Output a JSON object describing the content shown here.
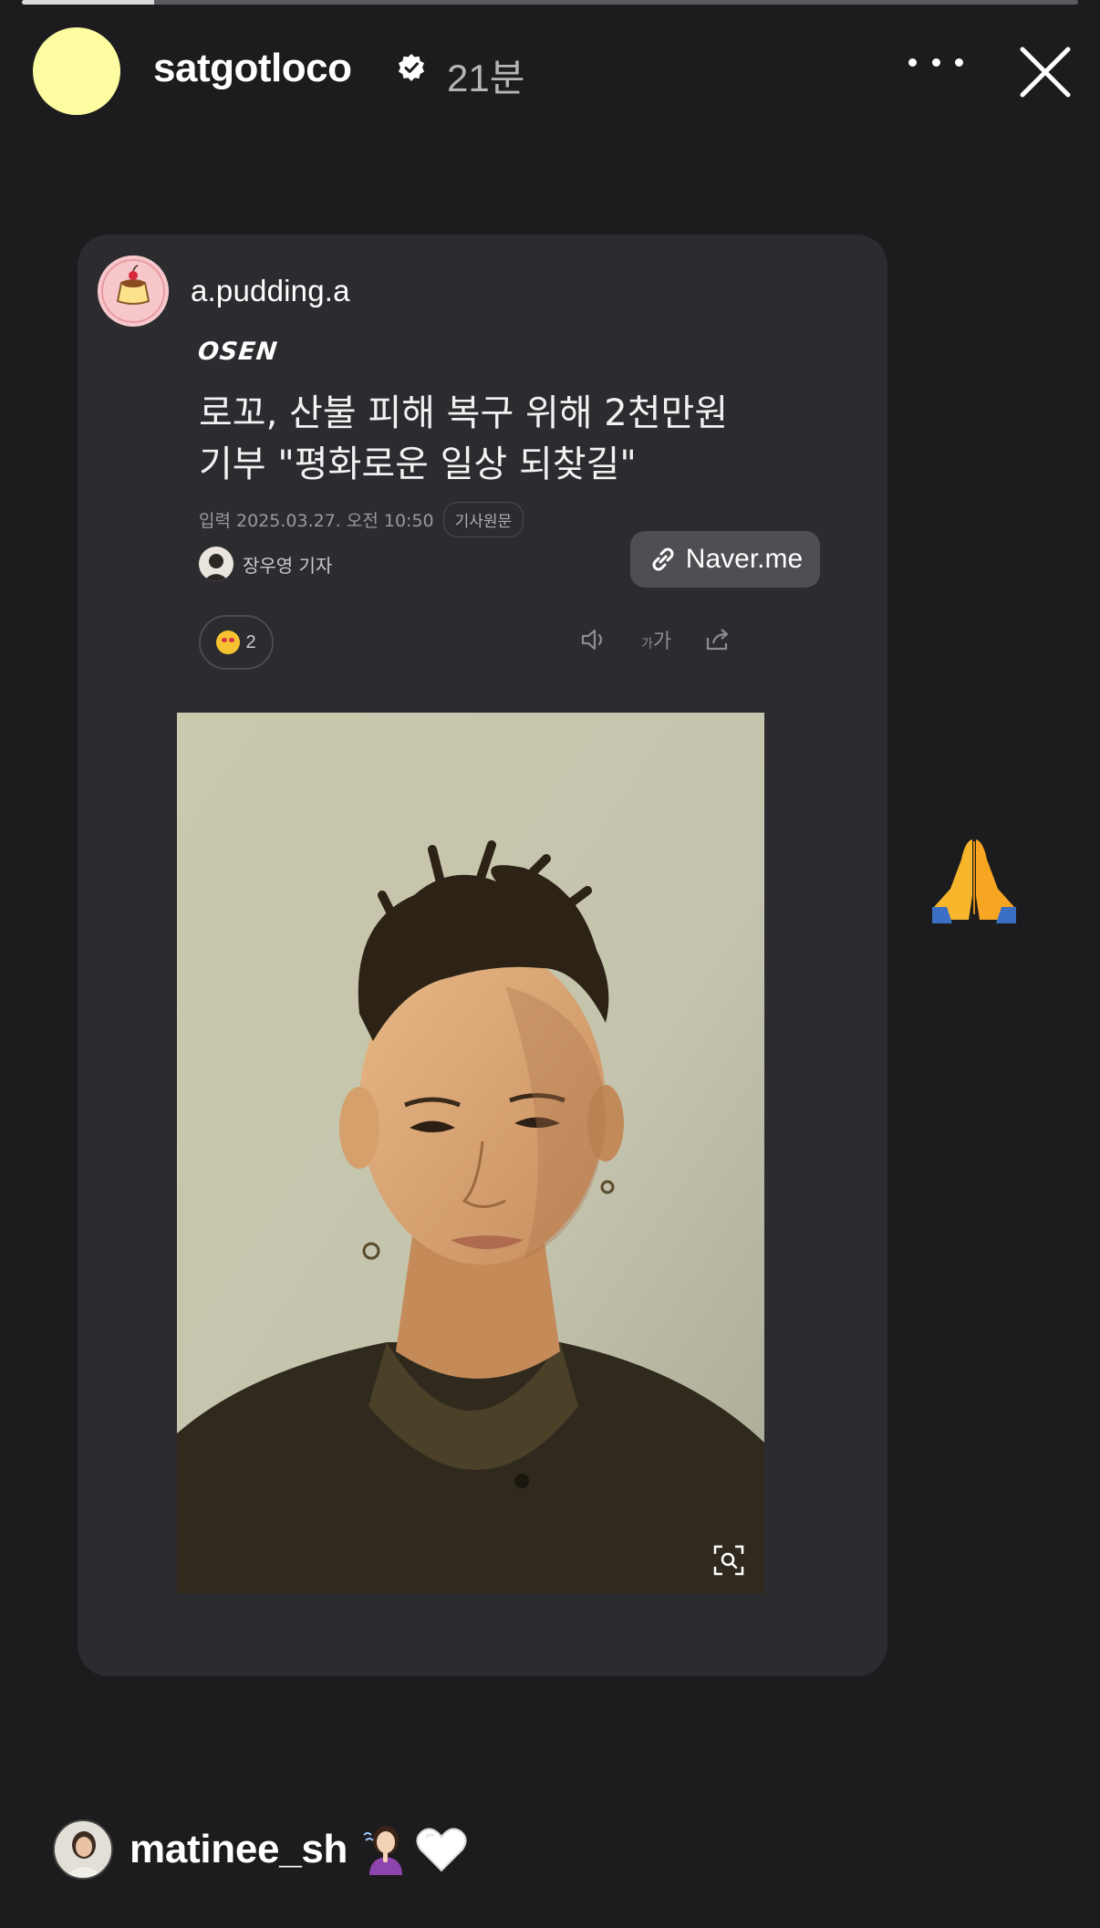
{
  "story": {
    "progress_fraction": 0.125,
    "username": "satgotloco",
    "verified": true,
    "time_ago": "21분",
    "avatar_color": "#fdfca0"
  },
  "header": {
    "more_icon": "more-horizontal-icon",
    "close_icon": "close-icon"
  },
  "shared_post": {
    "username": "a.pudding.a",
    "publisher": "OSEN",
    "headline_lines": [
      "로꼬, 산불 피해 복구 위해 2천만원",
      "기부 \"평화로운 일상 되찾길\""
    ],
    "date_line": "입력 2025.03.27. 오전 10:50",
    "original_button": "기사원문",
    "reporter": "장우영 기자",
    "reaction_count": "2",
    "font_size_label_small": "가",
    "font_size_label_large": "가"
  },
  "link_sticker": {
    "label": "Naver.me",
    "icon": "link-icon"
  },
  "sticker_emoji": "folded-hands",
  "mention": {
    "username": "matinee_sh"
  },
  "colors": {
    "background": "#1c1c1e",
    "card": "#2c2c30",
    "link_sticker": "#4e4e53"
  }
}
